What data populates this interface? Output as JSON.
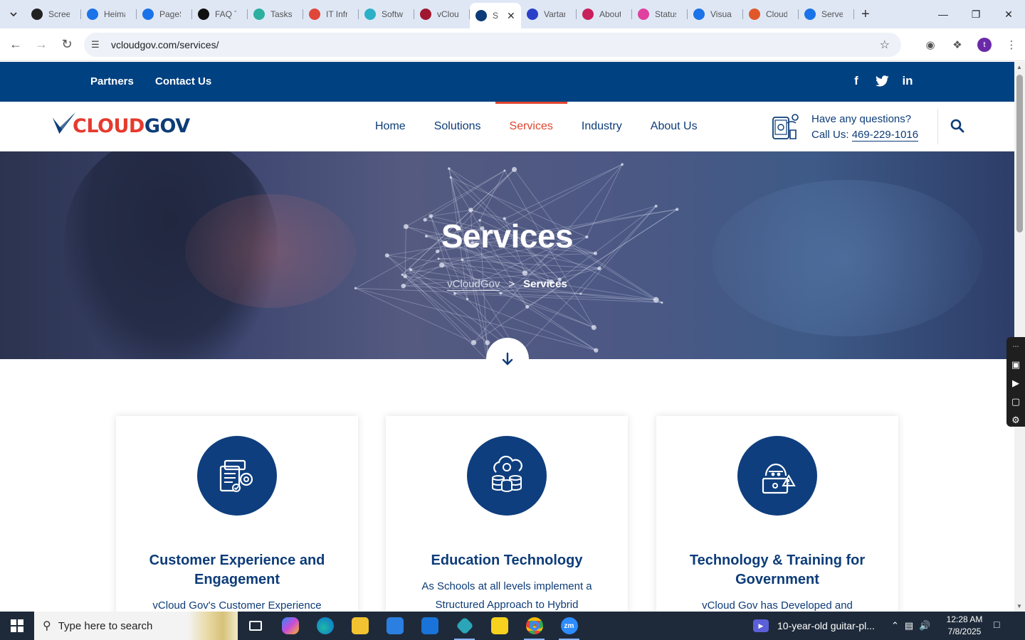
{
  "browser": {
    "tabs": [
      {
        "title": "Screen",
        "color": "#222222"
      },
      {
        "title": "Heima",
        "color": "#1a73e8"
      },
      {
        "title": "PageS",
        "color": "#1a73e8"
      },
      {
        "title": "FAQ T",
        "color": "#111111"
      },
      {
        "title": "Tasks",
        "color": "#2bb0a0"
      },
      {
        "title": "IT Infr",
        "color": "#e0463a"
      },
      {
        "title": "Softw",
        "color": "#2bb0c8"
      },
      {
        "title": "vClou",
        "color": "#a01830"
      },
      {
        "title": "Se",
        "color": "#0d3c78",
        "active": true
      },
      {
        "title": "Vartar",
        "color": "#2a40c8"
      },
      {
        "title": "About",
        "color": "#c8205a"
      },
      {
        "title": "Status",
        "color": "#e040a0"
      },
      {
        "title": "Visual",
        "color": "#1a73e8"
      },
      {
        "title": "Cloud",
        "color": "#e0582a"
      },
      {
        "title": "Serve",
        "color": "#1a73e8"
      }
    ],
    "url": "vcloudgov.com/services/",
    "profile_initial": "t"
  },
  "site": {
    "topbar": {
      "partners": "Partners",
      "contact": "Contact Us"
    },
    "logo": {
      "cloud": "CLOUD",
      "gov": "GOV"
    },
    "nav": [
      "Home",
      "Solutions",
      "Services",
      "Industry",
      "About Us"
    ],
    "nav_active": "Services",
    "contact": {
      "question": "Have any questions?",
      "call_label": "Call Us: ",
      "phone": "469-229-1016"
    },
    "hero": {
      "title": "Services",
      "crumb_home": "vCloudGov",
      "crumb_sep": ">",
      "crumb_current": "Services"
    },
    "cards": [
      {
        "title": "Customer Experience and Engagement",
        "text": "vCloud Gov's Customer Experience"
      },
      {
        "title": "Education Technology",
        "text": "As Schools at all levels implement a Structured Approach to Hybrid"
      },
      {
        "title": "Technology & Training for Government",
        "text": "vCloud Gov has Developed and"
      }
    ],
    "colors": {
      "primary": "#004181",
      "accent": "#e0462f",
      "text": "#0d3c78"
    }
  },
  "taskbar": {
    "search_placeholder": "Type here to search",
    "media": "10-year-old guitar-pl...",
    "time": "12:28 AM",
    "date": "7/8/2025"
  }
}
